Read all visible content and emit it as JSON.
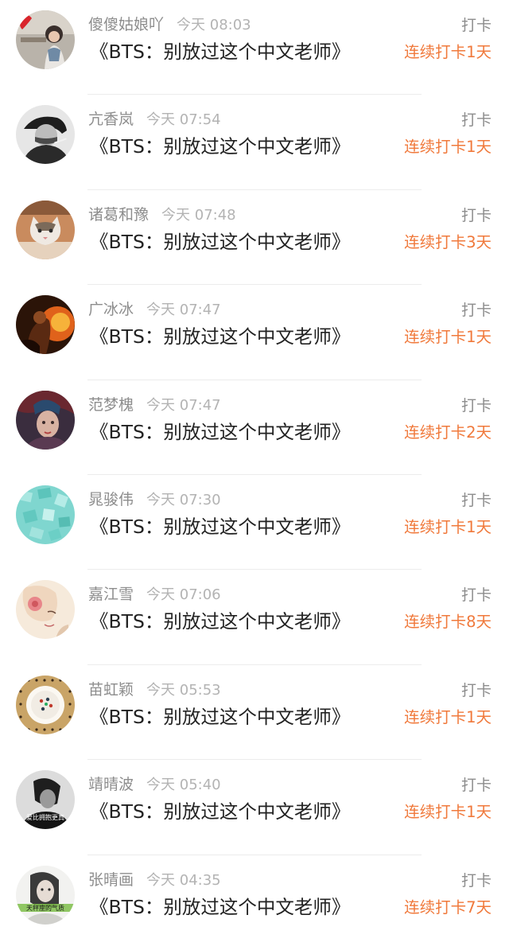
{
  "feed": {
    "items": [
      {
        "name": "傻傻姑娘吖",
        "time": "今天 08:03",
        "title": "《BTS：别放过这个中文老师》",
        "tag": "打卡",
        "streak": "连续打卡1天",
        "avatar_icon": "avatar-girl-photo-icon"
      },
      {
        "name": "亢香岚",
        "time": "今天 07:54",
        "title": "《BTS：别放过这个中文老师》",
        "tag": "打卡",
        "streak": "连续打卡1天",
        "avatar_icon": "avatar-bw-portrait-icon"
      },
      {
        "name": "诸葛和豫",
        "time": "今天 07:48",
        "title": "《BTS：别放过这个中文老师》",
        "tag": "打卡",
        "streak": "连续打卡3天",
        "avatar_icon": "avatar-cat-icon"
      },
      {
        "name": "广冰冰",
        "time": "今天 07:47",
        "title": "《BTS：别放过这个中文老师》",
        "tag": "打卡",
        "streak": "连续打卡1天",
        "avatar_icon": "avatar-fire-warrior-icon"
      },
      {
        "name": "范梦槐",
        "time": "今天 07:47",
        "title": "《BTS：别放过这个中文老师》",
        "tag": "打卡",
        "streak": "连续打卡2天",
        "avatar_icon": "avatar-game-character-icon"
      },
      {
        "name": "晁骏伟",
        "time": "今天 07:30",
        "title": "《BTS：别放过这个中文老师》",
        "tag": "打卡",
        "streak": "连续打卡1天",
        "avatar_icon": "avatar-teal-texture-icon"
      },
      {
        "name": "嘉江雪",
        "time": "今天 07:06",
        "title": "《BTS：别放过这个中文老师》",
        "tag": "打卡",
        "streak": "连续打卡8天",
        "avatar_icon": "avatar-illustrated-girl-icon"
      },
      {
        "name": "苗虹颖",
        "time": "今天 05:53",
        "title": "《BTS：别放过这个中文老师》",
        "tag": "打卡",
        "streak": "连续打卡1天",
        "avatar_icon": "avatar-plate-icon"
      },
      {
        "name": "靖晴波",
        "time": "今天 05:40",
        "title": "《BTS：别放过这个中文老师》",
        "tag": "打卡",
        "streak": "连续打卡1天",
        "avatar_icon": "avatar-dark-portrait-icon",
        "avatar_text": "爱比拥抱更真"
      },
      {
        "name": "张晴画",
        "time": "今天 04:35",
        "title": "《BTS：别放过这个中文老师》",
        "tag": "打卡",
        "streak": "连续打卡7天",
        "avatar_icon": "avatar-light-portrait-icon",
        "avatar_text": "天秤座的气质"
      }
    ]
  },
  "colors": {
    "streak": "#f0793b",
    "name": "#8d8d8d",
    "time": "#b3b3b3",
    "title": "#222222",
    "divider": "#ececec"
  }
}
